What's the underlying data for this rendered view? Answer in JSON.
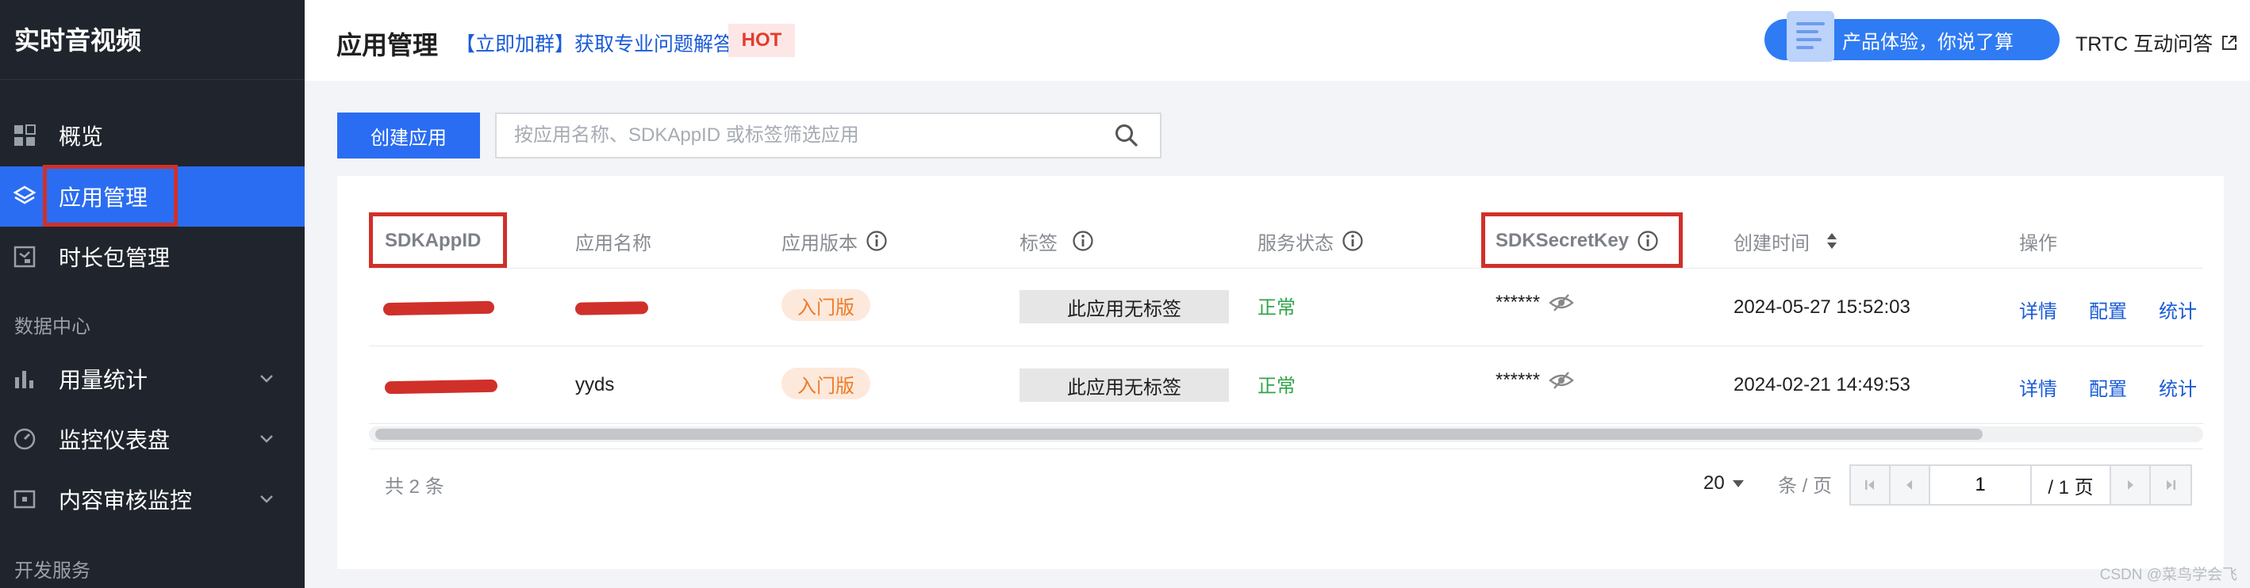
{
  "sidebar": {
    "app_title": "实时音视频",
    "items": [
      {
        "label": "概览",
        "icon": "grid-icon"
      },
      {
        "label": "应用管理",
        "icon": "layers-icon",
        "active": true
      },
      {
        "label": "时长包管理",
        "icon": "package-icon"
      }
    ],
    "section_data": "数据中心",
    "data_items": [
      {
        "label": "用量统计",
        "icon": "bar-chart-icon"
      },
      {
        "label": "监控仪表盘",
        "icon": "gauge-icon"
      },
      {
        "label": "内容审核监控",
        "icon": "monitor-icon"
      }
    ],
    "section_dev": "开发服务"
  },
  "header": {
    "title": "应用管理",
    "join_link": "【立即加群】获取专业问题解答",
    "hot_badge": "HOT",
    "feedback_button": "产品体验，你说了算",
    "qa_link": "TRTC 互动问答"
  },
  "toolbar": {
    "create_button": "创建应用",
    "search_placeholder": "按应用名称、SDKAppID 或标签筛选应用"
  },
  "table": {
    "columns": [
      "SDKAppID",
      "应用名称",
      "应用版本",
      "标签",
      "服务状态",
      "SDKSecretKey",
      "创建时间",
      "操作"
    ],
    "rows": [
      {
        "app_name": "",
        "version": "入门版",
        "tag": "此应用无标签",
        "status": "正常",
        "secret": "******",
        "created": "2024-05-27 15:52:03",
        "ops": [
          "详情",
          "配置",
          "统计"
        ]
      },
      {
        "app_name": "yyds",
        "version": "入门版",
        "tag": "此应用无标签",
        "status": "正常",
        "secret": "******",
        "created": "2024-02-21 14:49:53",
        "ops": [
          "详情",
          "配置",
          "统计"
        ]
      }
    ]
  },
  "pagination": {
    "total": "共 2 条",
    "page_size": "20",
    "per_page_label": "条 / 页",
    "current_page": "1",
    "total_pages": "/ 1 页"
  },
  "watermark": "CSDN @菜鸟学会飞",
  "colors": {
    "accent": "#2b6df2",
    "sidebar_bg": "#20252d",
    "highlight": "#d0302a",
    "status_ok": "#30a54a",
    "link": "#1a5bd8"
  }
}
